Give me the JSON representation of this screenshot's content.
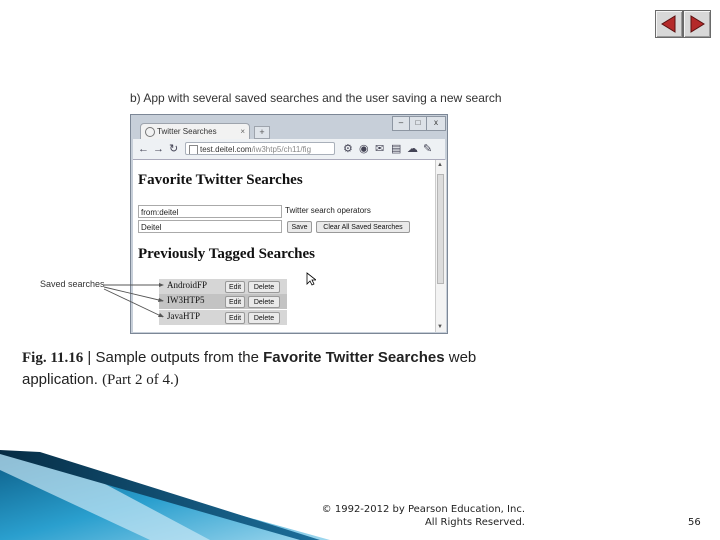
{
  "slide": {
    "caption_b": "b) App with several saved searches and the user saving a new search",
    "saved_searches_label": "Saved searches",
    "figure_number": "Fig. 11.16",
    "figure_sep": " | ",
    "figure_text": "Sample outputs from the ",
    "figure_app": "Favorite Twitter Searches",
    "figure_text2": " web application. ",
    "figure_part": "(Part 2 of 4.)",
    "copyright_line1": "© 1992-2012 by Pearson Education, Inc.",
    "copyright_line2": "All Rights Reserved.",
    "page_number": "56"
  },
  "browser": {
    "tab_title": "Twitter Searches",
    "tab_close": "×",
    "new_tab": "+",
    "address_host": "test.deitel.com",
    "address_path": "/iw3htp5/ch11/fig",
    "win_min": "–",
    "win_max": "□",
    "win_close": "x"
  },
  "page": {
    "title": "Favorite Twitter Searches",
    "query_value": "from:deitel",
    "tag_value": "Deitel",
    "operators_link": "Twitter search operators",
    "save_label": "Save",
    "clear_label": "Clear All Saved Searches",
    "section_title": "Previously Tagged Searches",
    "edit_label": "Edit",
    "delete_label": "Delete",
    "rows": [
      {
        "tag": "AndroidFP"
      },
      {
        "tag": "IW3HTP5"
      },
      {
        "tag": "JavaHTP"
      }
    ]
  },
  "colors": {
    "accent_blue": "#1f84b3",
    "nav_red": "#b42a2a"
  }
}
